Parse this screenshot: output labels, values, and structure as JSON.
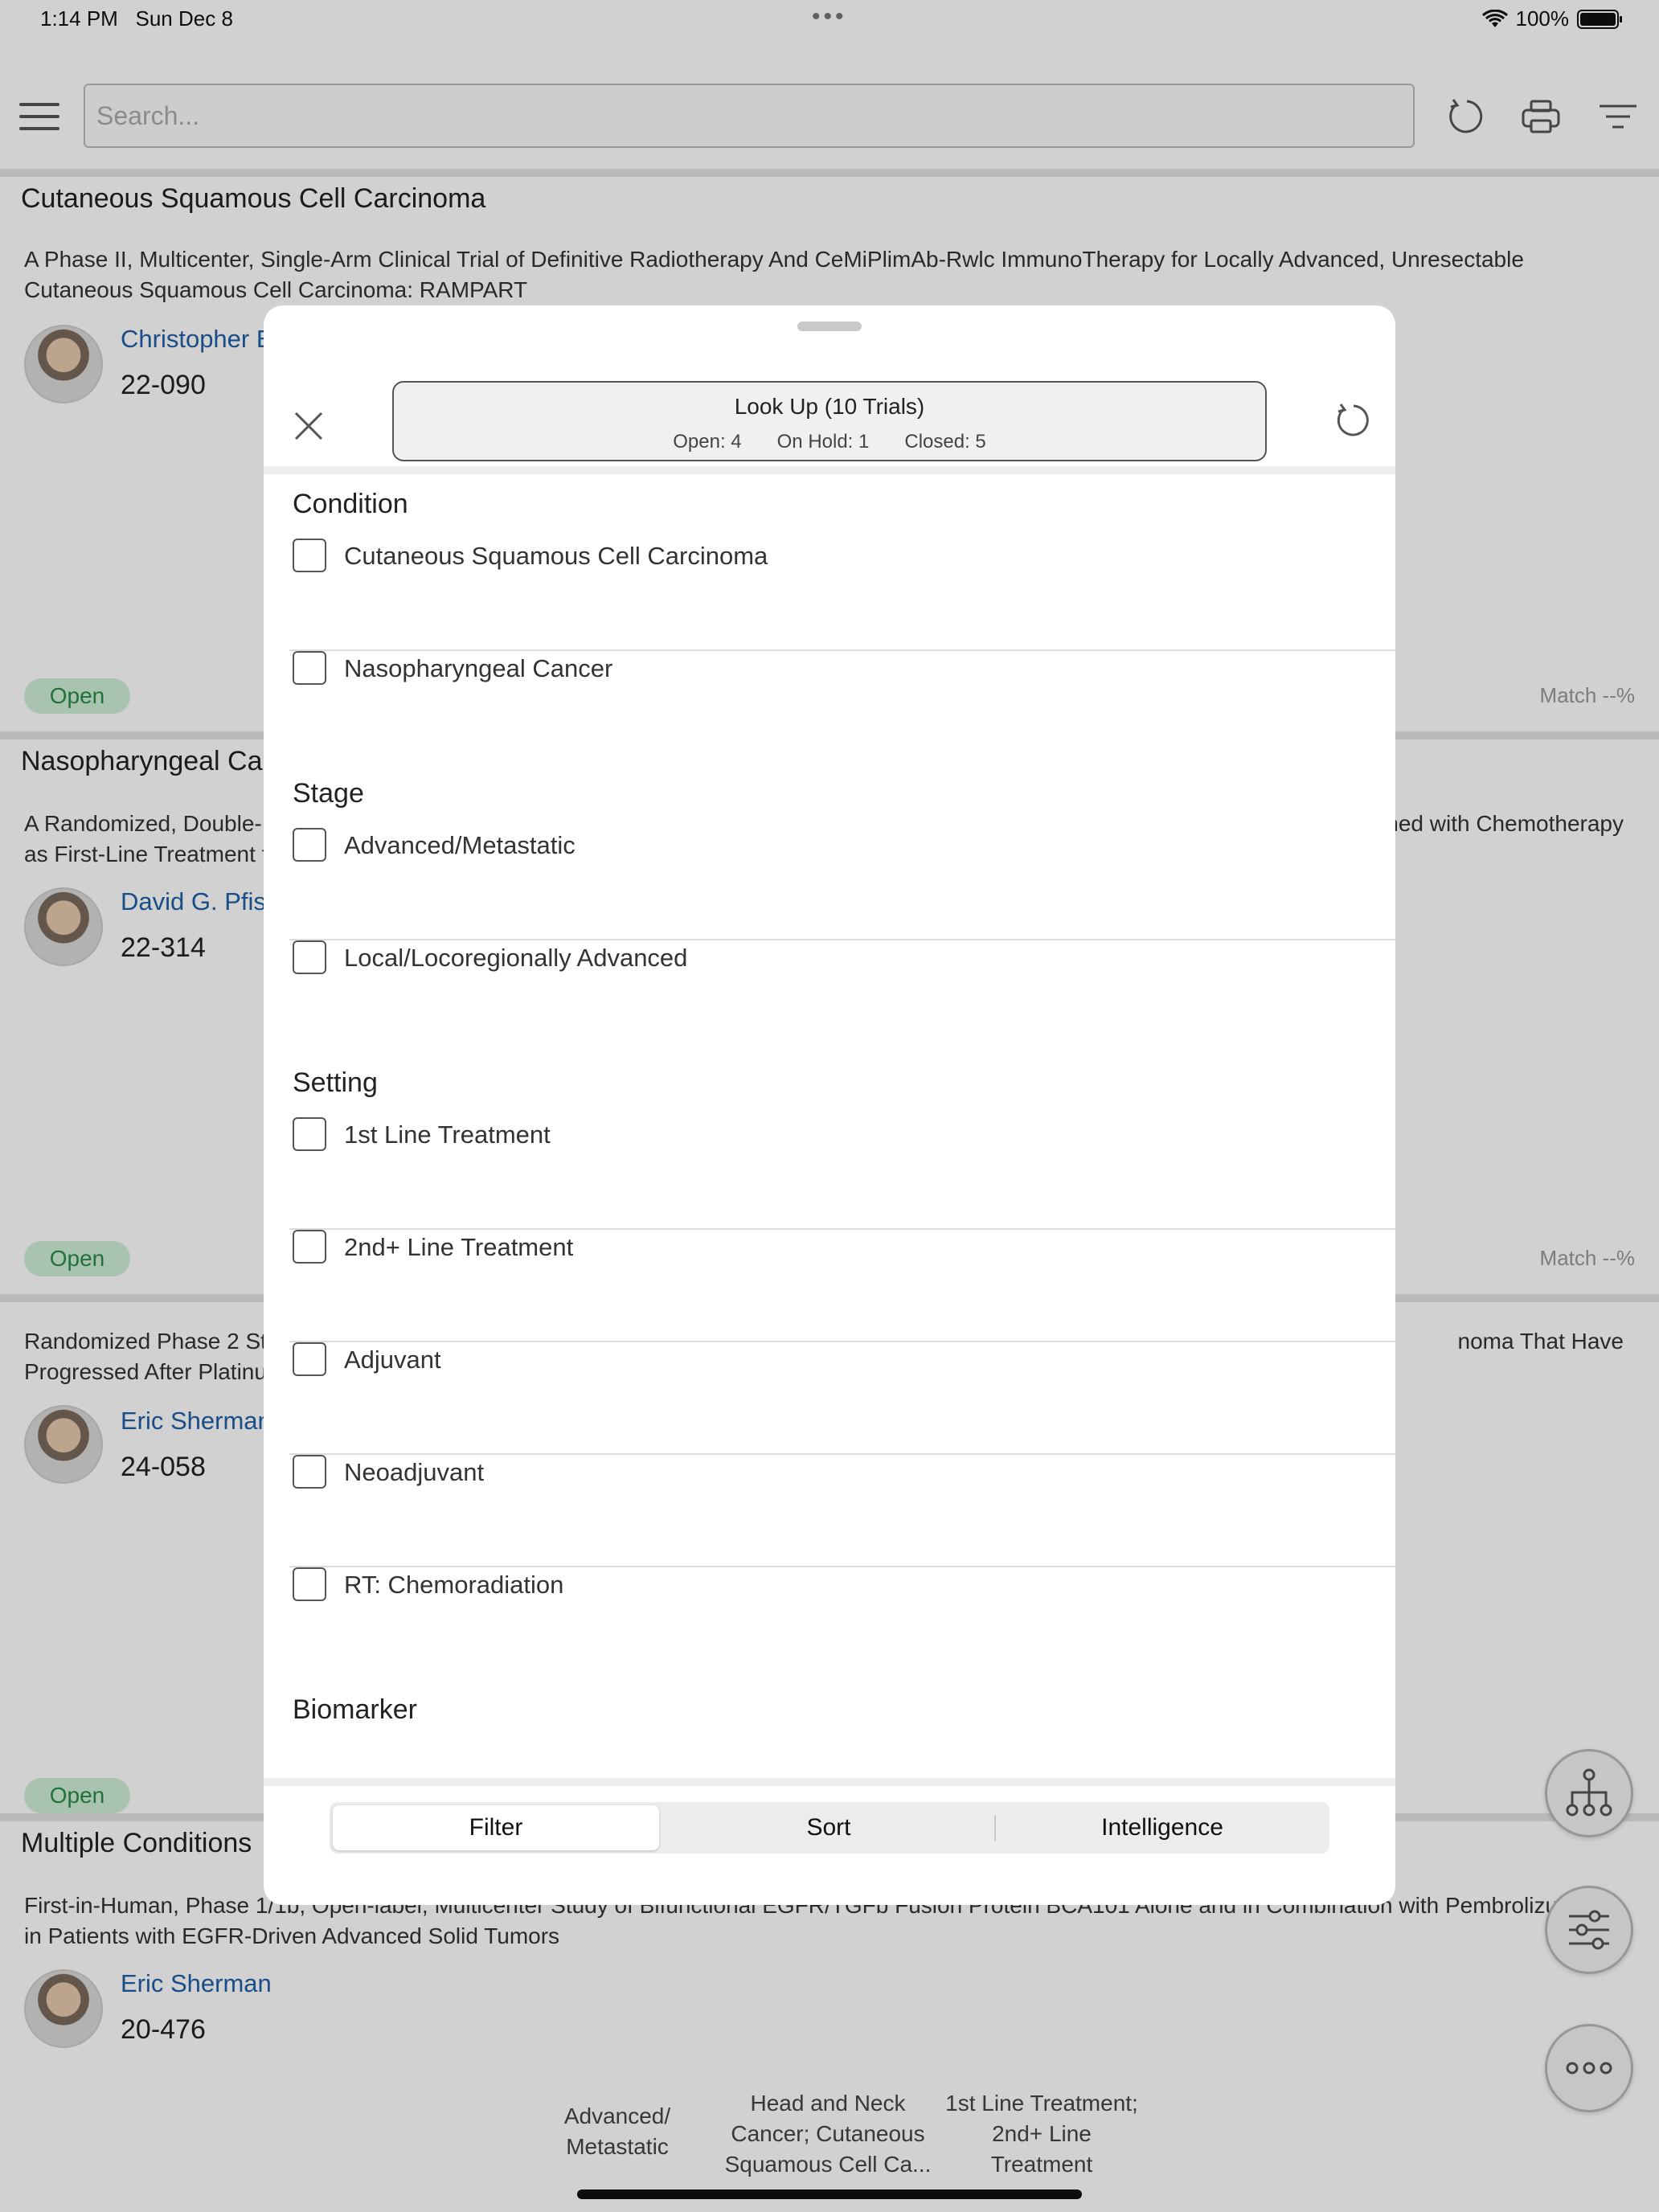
{
  "status_bar": {
    "time": "1:14 PM",
    "date": "Sun Dec 8",
    "battery": "100%"
  },
  "search": {
    "placeholder": "Search..."
  },
  "cards": [
    {
      "condition": "Cutaneous Squamous Cell Carcinoma",
      "description": "A Phase II, Multicenter, Single-Arm Clinical Trial of Definitive Radiotherapy And CeMiPlimAb-Rwlc ImmunoTherapy for Locally Advanced, Unresectable Cutaneous Squamous Cell Carcinoma: RAMPART",
      "pi": "Christopher E",
      "protocol": "22-090",
      "status": "Open",
      "match": "Match --%"
    },
    {
      "condition": "Nasopharyngeal Ca",
      "description_left": "A Randomized, Double-",
      "description_right": "ned with Chemotherapy",
      "description_line2": "as First-Line Treatment f",
      "pi": "David G. Pfist",
      "protocol": "22-314",
      "status": "Open",
      "match": "Match --%"
    },
    {
      "description_left": "Randomized Phase 2 Stu",
      "description_right": "noma That Have",
      "description_line2": "Progressed After Platinu",
      "pi": "Eric Sherman",
      "protocol": "24-058",
      "status": "Open"
    },
    {
      "condition": "Multiple Conditions",
      "description": "First-in-Human, Phase 1/1b, Open-label, Multicenter Study of Bifunctional EGFR/TGFb Fusion Protein BCA101 Alone and in Combination with Pembrolizumab in Patients with EGFR-Driven Advanced Solid Tumors",
      "pi": "Eric Sherman",
      "protocol": "20-476"
    }
  ],
  "bottom_bar": {
    "stage": "Advanced/\nMetastatic",
    "condition": "Head and Neck\nCancer; Cutaneous\nSquamous Cell Ca...",
    "setting": "1st Line Treatment;\n2nd+ Line\nTreatment"
  },
  "sheet": {
    "lookup_title": "Look Up (10 Trials)",
    "open": "Open: 4",
    "on_hold": "On Hold: 1",
    "closed": "Closed: 5",
    "sections": {
      "condition": "Condition",
      "stage": "Stage",
      "setting": "Setting",
      "biomarker": "Biomarker"
    },
    "options": {
      "cscc": "Cutaneous Squamous Cell Carcinoma",
      "naso": "Nasopharyngeal Cancer",
      "advanced": "Advanced/Metastatic",
      "local": "Local/Locoregionally Advanced",
      "line1": "1st Line Treatment",
      "line2": "2nd+ Line Treatment",
      "adjuvant": "Adjuvant",
      "neoadjuvant": "Neoadjuvant",
      "rt": "RT: Chemoradiation"
    },
    "tabs": {
      "filter": "Filter",
      "sort": "Sort",
      "intelligence": "Intelligence"
    }
  },
  "colors": {
    "accent_link": "#1f5fa6",
    "open_badge_bg": "#cdeed6",
    "open_badge_text": "#2a8a4a"
  }
}
